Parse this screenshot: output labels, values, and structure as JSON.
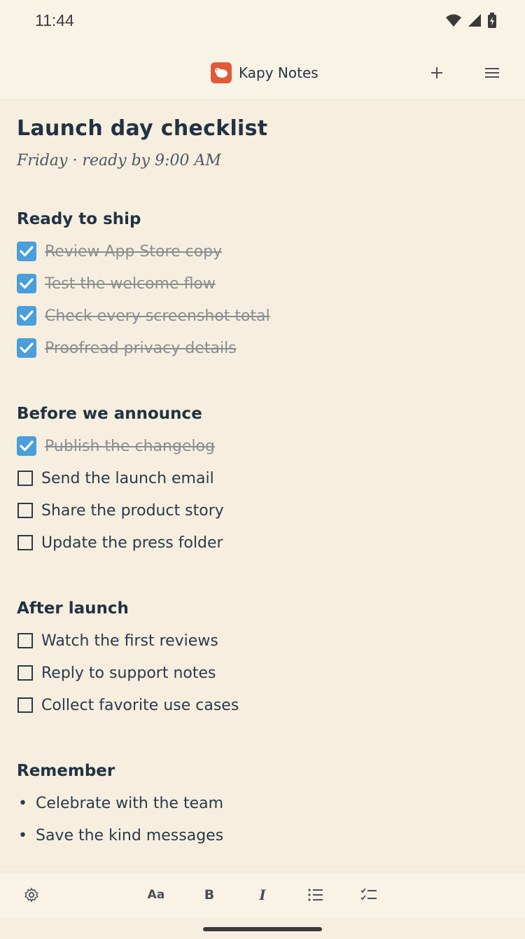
{
  "status_bar": {
    "time": "11:44",
    "icons": [
      "wifi-icon",
      "signal-icon",
      "battery-icon"
    ]
  },
  "header": {
    "app_name": "Kapy Notes",
    "logo_icon": "kapy-logo-icon",
    "add_icon": "plus-icon",
    "menu_icon": "hamburger-menu-icon"
  },
  "note": {
    "title": "Launch day checklist",
    "subtitle": "Friday · ready by 9:00 AM",
    "sections": [
      {
        "title": "Ready to ship",
        "items": [
          {
            "text": "Review App Store copy",
            "done": true
          },
          {
            "text": "Test the welcome flow",
            "done": true
          },
          {
            "text": "Check every screenshot total",
            "done": true
          },
          {
            "text": "Proofread privacy details",
            "done": true
          }
        ]
      },
      {
        "title": "Before we announce",
        "items": [
          {
            "text": "Publish the changelog",
            "done": true
          },
          {
            "text": "Send the launch email",
            "done": false
          },
          {
            "text": "Share the product story",
            "done": false
          },
          {
            "text": "Update the press folder",
            "done": false
          }
        ]
      },
      {
        "title": "After launch",
        "items": [
          {
            "text": "Watch the first reviews",
            "done": false
          },
          {
            "text": "Reply to support notes",
            "done": false
          },
          {
            "text": "Collect favorite use cases",
            "done": false
          }
        ]
      },
      {
        "title": "Remember",
        "bullets": [
          "Celebrate with the team",
          "Save the kind messages"
        ]
      }
    ]
  },
  "toolbar": {
    "settings_icon": "gear-icon",
    "text_format_label": "Aa",
    "bold_label": "B",
    "italic_label": "I",
    "list_icon": "bulleted-list-icon",
    "checklist_icon": "checklist-icon"
  },
  "colors": {
    "background": "#f6efdf",
    "accent": "#e15a36",
    "checkbox_done": "#4a9edb",
    "text": "#253444"
  }
}
